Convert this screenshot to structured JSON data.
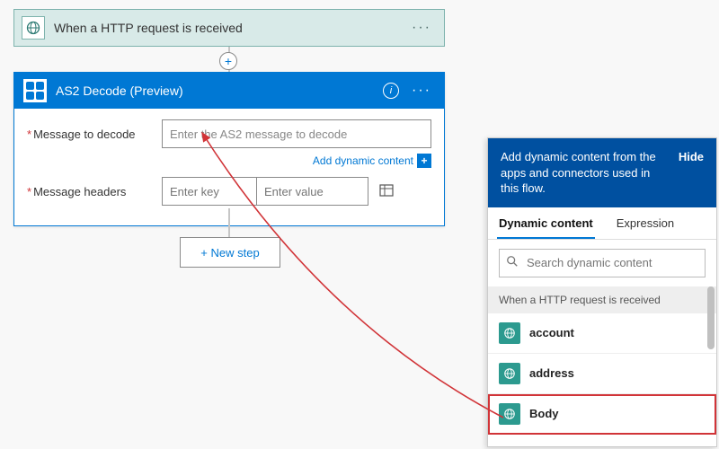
{
  "trigger": {
    "title": "When a HTTP request is received",
    "icon": "globe-icon"
  },
  "action": {
    "title": "AS2 Decode",
    "preview": "(Preview)",
    "icon": "grid-icon",
    "fields": {
      "message_label": "Message to decode",
      "message_placeholder": "Enter the AS2 message to decode",
      "headers_label": "Message headers",
      "key_placeholder": "Enter key",
      "value_placeholder": "Enter value"
    },
    "add_dynamic_content_label": "Add dynamic content"
  },
  "new_step_label": "+ New step",
  "dynamic_panel": {
    "heading": "Add dynamic content from the apps and connectors used in this flow.",
    "hide_label": "Hide",
    "tabs": {
      "dynamic": "Dynamic content",
      "expression": "Expression"
    },
    "search_placeholder": "Search dynamic content",
    "group_title": "When a HTTP request is received",
    "items": [
      {
        "label": "account"
      },
      {
        "label": "address"
      },
      {
        "label": "Body"
      }
    ]
  }
}
